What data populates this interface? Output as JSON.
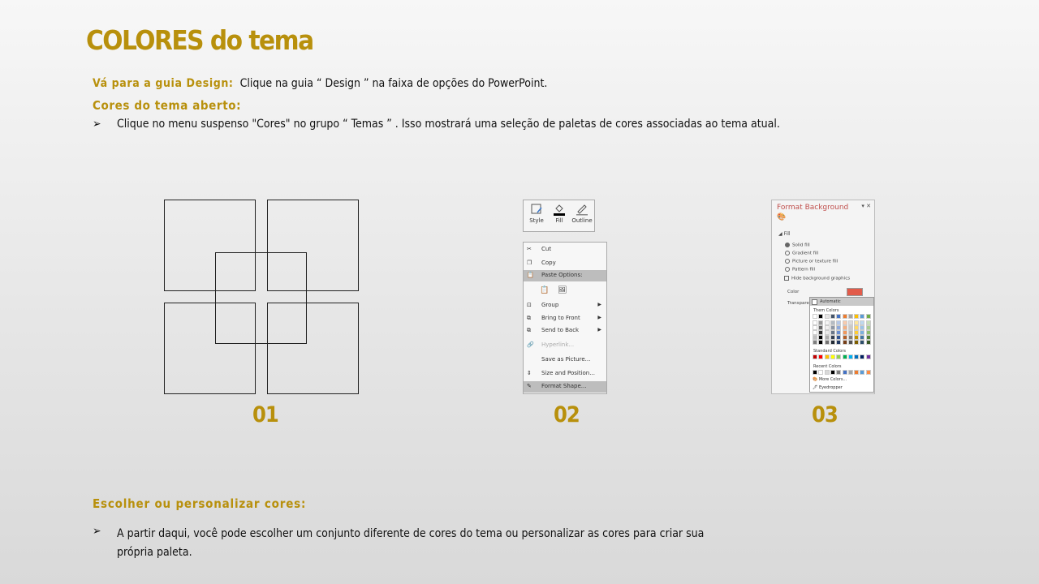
{
  "title": "COLORES do tema",
  "step1": {
    "label": "Vá para a guia Design:",
    "text": "Clique na guia “ Design ” na faixa de opções do PowerPoint."
  },
  "step2": {
    "label": "Cores do tema aberto:",
    "bullet": "Clique no menu suspenso \"Cores\" no grupo “ Temas ” . Isso mostrará uma seleção de paletas de cores associadas ao tema atual."
  },
  "step3": {
    "label": "Escolher ou personalizar cores:",
    "bullet": "A partir daqui, você pode escolher um conjunto diferente de cores do tema ou personalizar as cores para criar sua própria paleta."
  },
  "bullet_glyph": "➢",
  "figures": {
    "f1": "01",
    "f2": "02",
    "f3": "03"
  },
  "ribbon": {
    "style": "Style",
    "fill": "Fill",
    "outline": "Outline"
  },
  "menu": {
    "cut": "Cut",
    "copy": "Copy",
    "paste_options": "Paste Options:",
    "group": "Group",
    "bring_front": "Bring to Front",
    "send_back": "Send to Back",
    "hyperlink": "Hyperlink...",
    "save_picture": "Save as Picture...",
    "size_position": "Size and Position...",
    "format_shape": "Format Shape..."
  },
  "pane": {
    "title": "Format Background",
    "fill": "Fill",
    "solid": "Solid fill",
    "gradient": "Gradient fill",
    "picture": "Picture or texture fill",
    "pattern": "Pattern fill",
    "hide": "Hide background graphics",
    "color": "Color",
    "transparency": "Transpare"
  },
  "picker": {
    "automatic": "Automatic",
    "theme": "Them Colors",
    "standard": "Standard Colors",
    "recent": "Recent Colors",
    "more": "More Colors...",
    "eyedropper": "Eyedropper"
  },
  "colors": {
    "accent": "#b8900c",
    "theme_row": [
      "#ffffff",
      "#000000",
      "#e7e6e6",
      "#44546a",
      "#4472c4",
      "#ed7d31",
      "#a5a5a5",
      "#ffc000",
      "#5b9bd5",
      "#70ad47"
    ],
    "standard_row": [
      "#c00000",
      "#ff0000",
      "#ffc000",
      "#ffff00",
      "#92d050",
      "#00b050",
      "#00b0f0",
      "#0070c0",
      "#002060",
      "#7030a0"
    ],
    "recent_row": [
      "#000000",
      "#ffffff",
      "#d9d9d9",
      "#000000",
      "#808080",
      "#4472c4",
      "#a5a5a5",
      "#ed7d31",
      "#5b9bd5",
      "#ff8c42"
    ]
  }
}
